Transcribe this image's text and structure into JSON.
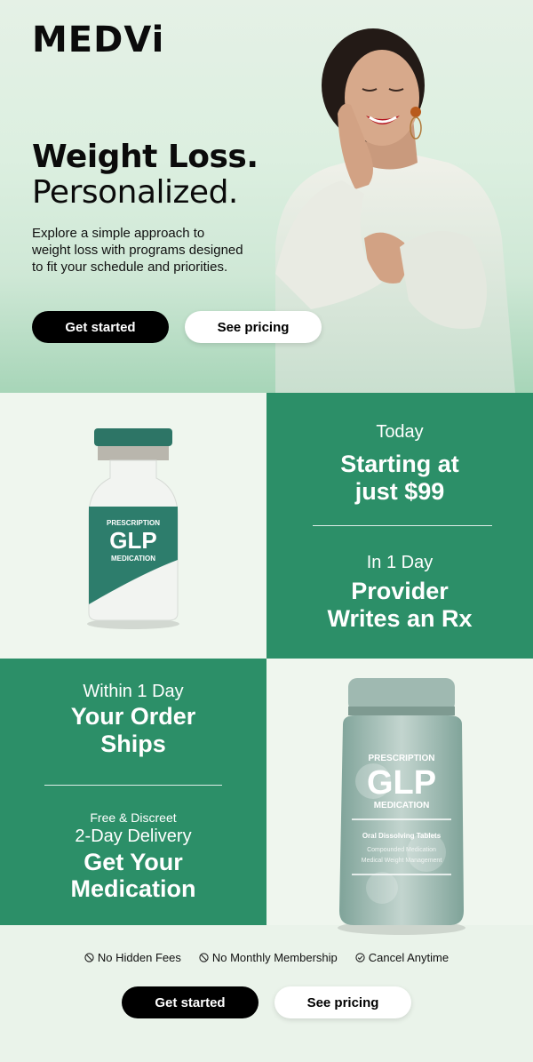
{
  "brand": {
    "logo": "MEDVi"
  },
  "hero": {
    "headline_bold": "Weight Loss.",
    "headline_regular": "Personalized.",
    "description": "Explore a simple approach to weight loss with programs designed to fit your schedule and priorities.",
    "primary_button": "Get started",
    "secondary_button": "See pricing"
  },
  "vial": {
    "line1": "PRESCRIPTION",
    "line2": "GLP",
    "line3": "MEDICATION"
  },
  "card_today": {
    "eyebrow": "Today",
    "title_line1": "Starting at",
    "title_line2": "just $99"
  },
  "card_rx": {
    "eyebrow": "In 1 Day",
    "title_line1": "Provider",
    "title_line2": "Writes an Rx"
  },
  "card_ships": {
    "eyebrow": "Within 1 Day",
    "title_line1": "Your Order",
    "title_line2": "Ships"
  },
  "card_delivery": {
    "eyebrow_small": "Free & Discreet",
    "eyebrow": "2-Day Delivery",
    "title_line1": "Get Your",
    "title_line2": "Medication"
  },
  "bottle": {
    "line1": "PRESCRIPTION",
    "line2": "GLP",
    "line3": "MEDICATION",
    "line4": "Oral Dissolving Tablets",
    "line5": "Compounded Medication",
    "line6": "Medical Weight Management"
  },
  "perks": [
    {
      "label": "No Hidden Fees",
      "icon": "no-sign-icon"
    },
    {
      "label": "No Monthly Membership",
      "icon": "no-sign-icon"
    },
    {
      "label": "Cancel Anytime",
      "icon": "check-circle-icon"
    }
  ],
  "footer_cta": {
    "primary_button": "Get started",
    "secondary_button": "See pricing"
  },
  "colors": {
    "brand_green": "#2c8f68",
    "hero_bg": "#dcefe0",
    "cell_light": "#eff6ee",
    "dark_button": "#000000"
  }
}
